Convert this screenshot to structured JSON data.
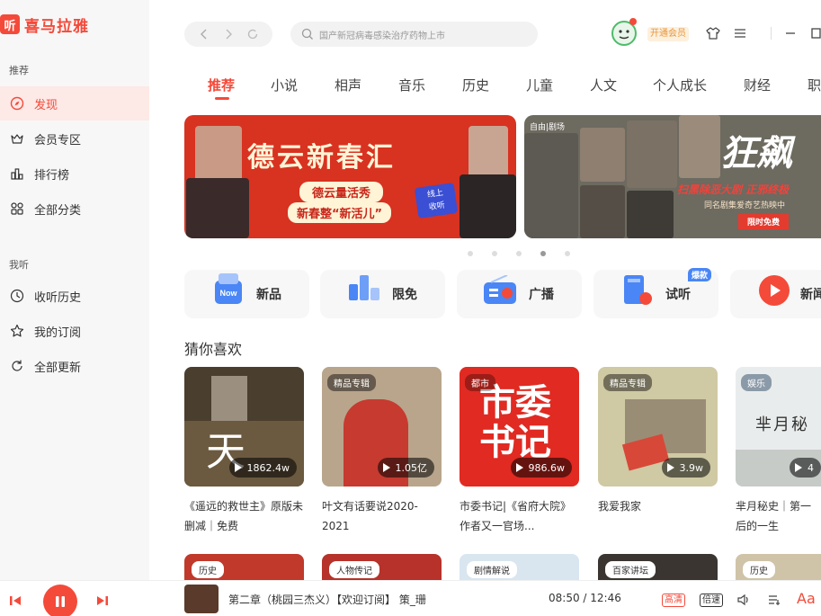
{
  "app": {
    "logo_mark": "听",
    "name": "喜马拉雅"
  },
  "sidebar": {
    "section1": "推荐",
    "items1": [
      {
        "label": "发现"
      },
      {
        "label": "会员专区"
      },
      {
        "label": "排行榜"
      },
      {
        "label": "全部分类"
      }
    ],
    "section2": "我听",
    "items2": [
      {
        "label": "收听历史"
      },
      {
        "label": "我的订阅"
      },
      {
        "label": "全部更新"
      }
    ]
  },
  "topbar": {
    "search_placeholder": "国产新冠病毒感染治疗药物上市",
    "vip_label": "开通会员"
  },
  "tabs": [
    "推荐",
    "小说",
    "相声",
    "音乐",
    "历史",
    "儿童",
    "人文",
    "个人成长",
    "财经",
    "职"
  ],
  "banners": {
    "b1": {
      "title": "德云新春汇",
      "line1": "德云量活秀",
      "line2": "新春整“新活儿”",
      "badge1": "线上",
      "badge2": "收听"
    },
    "b2": {
      "tag": "自由|剧场",
      "title": "狂飙",
      "line1": "扫黑除恶大剧 正邪终极",
      "line2": "同名剧集爱奇艺热映中",
      "cta": "限时免费"
    }
  },
  "quick": [
    {
      "label": "新品",
      "icon_badge": "Now"
    },
    {
      "label": "限免"
    },
    {
      "label": "广播"
    },
    {
      "label": "试听",
      "icon_badge": "爆款"
    },
    {
      "label": "新闻"
    }
  ],
  "section_title": "猜你喜欢",
  "cards": [
    {
      "plays": "1862.4w",
      "title": "《遥远的救世主》原版未删减｜免费",
      "cover_text": "天"
    },
    {
      "tag": "精品专辑",
      "plays": "1.05亿",
      "title": "叶文有话要说2020-2021"
    },
    {
      "tag": "都市",
      "plays": "986.6w",
      "title": "市委书记|《省府大院》作者又一官场...",
      "cover_text": "市委书记"
    },
    {
      "tag": "精品专辑",
      "plays": "3.9w",
      "title": "我爱我家"
    },
    {
      "tag": "娱乐",
      "plays": "4",
      "title": "芈月秘史｜第一后的一生",
      "cover_text": "芈月秘"
    }
  ],
  "cards_row2": [
    {
      "tag": "历史"
    },
    {
      "tag": "人物传记"
    },
    {
      "tag": "剧情解说"
    },
    {
      "tag": "百家讲坛"
    },
    {
      "tag": "历史"
    }
  ],
  "player": {
    "track": "第二章（桃园三杰义）【欢迎订阅】 策_珊",
    "time": "08:50 / 12:46",
    "quality": "高清",
    "speed": "倍速",
    "font_btn": "Aa"
  },
  "colors": {
    "accent": "#f44a3a",
    "sidebar_bg": "#f7f7f7"
  }
}
